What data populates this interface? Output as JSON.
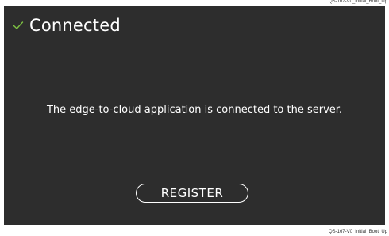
{
  "caption": {
    "top": "QS-167-V0_Initial_Boot_Up",
    "bottom": "QS-167-V0_Initial_Boot_Up"
  },
  "colors": {
    "screen_background": "#2d2d2d",
    "check_icon": "#7ec242",
    "text": "#ffffff"
  },
  "header": {
    "icon": "check-icon",
    "title": "Connected"
  },
  "message": "The edge-to-cloud application is connected to the server.",
  "register_button": {
    "label": "REGISTER"
  }
}
